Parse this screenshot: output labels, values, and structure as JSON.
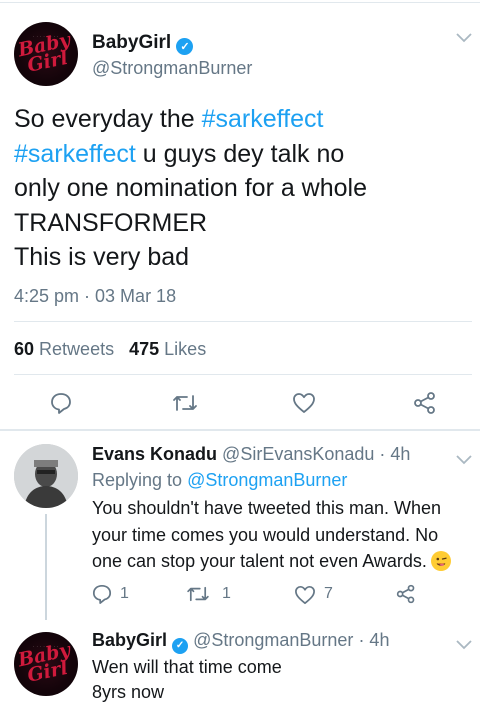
{
  "main_tweet": {
    "display_name": "BabyGirl",
    "handle": "@StrongmanBurner",
    "avatar_text": "Baby Girl",
    "body_prefix": "So everyday the ",
    "hashtag_1": "#sarkeffect",
    "hashtag_2": "#sarkeffect",
    "body_line_2_rest": " u guys dey talk no",
    "body_line_3": "only one nomination for a whole",
    "body_line_4": "TRANSFORMER",
    "body_line_5": "This is very bad",
    "timestamp": "4:25 pm · 03 Mar 18",
    "retweets_count": "60",
    "retweets_label": "Retweets",
    "likes_count": "475",
    "likes_label": "Likes"
  },
  "reply_1": {
    "display_name": "Evans Konadu",
    "handle": "@SirEvansKonadu",
    "time": "· 4h",
    "replying_to_label": "Replying to ",
    "replying_to_handle": "@StrongmanBurner",
    "text_line_1": "You shouldn't have tweeted this man. When",
    "text_line_2": "your time comes you would understand. No",
    "text_line_3": "one can stop your talent not even Awards.",
    "reply_count": "1",
    "retweet_count": "1",
    "like_count": "7"
  },
  "reply_2": {
    "display_name": "BabyGirl",
    "handle": "@StrongmanBurner",
    "time": "· 4h",
    "text_line_1": "Wen will that time come",
    "text_line_2": "8yrs now",
    "avatar_text": "Baby Girl"
  },
  "icons": [
    "chevron-down-icon",
    "verified-badge-icon",
    "reply-icon",
    "retweet-icon",
    "like-icon",
    "share-icon",
    "winking-face-emoji"
  ],
  "colors": {
    "link": "#1da1f2",
    "muted": "#657786",
    "text": "#14171a",
    "divider": "#e1e8ed"
  }
}
